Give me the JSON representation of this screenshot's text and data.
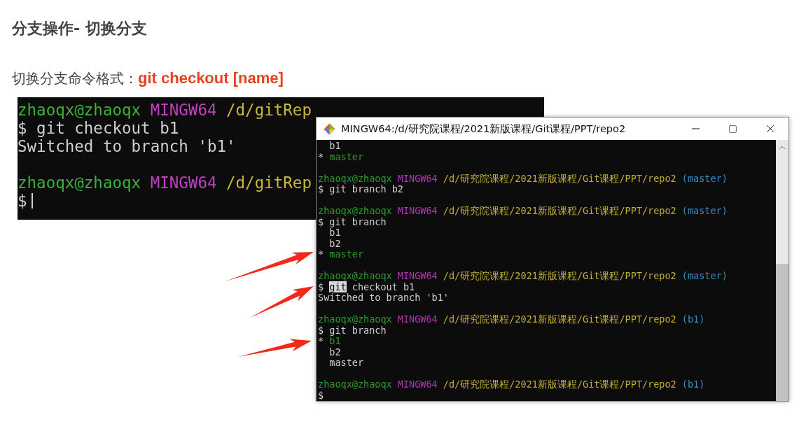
{
  "title": "分支操作- 切换分支",
  "subtitle": {
    "label": "切换分支命令格式：",
    "command": "git checkout [name]"
  },
  "back_terminal": {
    "lines": [
      {
        "kind": "prompt",
        "user": "zhaoqx@zhaoqx",
        "system": "MINGW64",
        "path": "/d/gitRep"
      },
      {
        "kind": "command",
        "prompt": "$",
        "parts": [
          {
            "text": "git checkout b1",
            "selected": false
          }
        ]
      },
      {
        "kind": "output",
        "text": "Switched to branch 'b1'"
      },
      {
        "kind": "blank"
      },
      {
        "kind": "prompt",
        "user": "zhaoqx@zhaoqx",
        "system": "MINGW64",
        "path": "/d/gitRep"
      },
      {
        "kind": "command",
        "prompt": "$",
        "cursor": true
      }
    ]
  },
  "terminal_window": {
    "title": "MINGW64:/d/研究院课程/2021新版课程/Git课程/PPT/repo2",
    "lines": [
      {
        "kind": "branch",
        "current": false,
        "name": "b1"
      },
      {
        "kind": "branch",
        "current": true,
        "marker": "*",
        "name": "master"
      },
      {
        "kind": "blank"
      },
      {
        "kind": "prompt",
        "user": "zhaoqx@zhaoqx",
        "system": "MINGW64",
        "path": "/d/研究院课程/2021新版课程/Git课程/PPT/repo2",
        "branch": "(master)"
      },
      {
        "kind": "command",
        "prompt": "$",
        "parts": [
          {
            "text": "git branch b2",
            "selected": false
          }
        ]
      },
      {
        "kind": "blank"
      },
      {
        "kind": "prompt",
        "user": "zhaoqx@zhaoqx",
        "system": "MINGW64",
        "path": "/d/研究院课程/2021新版课程/Git课程/PPT/repo2",
        "branch": "(master)"
      },
      {
        "kind": "command",
        "prompt": "$",
        "parts": [
          {
            "text": "git branch",
            "selected": false
          }
        ]
      },
      {
        "kind": "branch",
        "current": false,
        "name": "b1"
      },
      {
        "kind": "branch",
        "current": false,
        "name": "b2"
      },
      {
        "kind": "branch",
        "current": true,
        "marker": "*",
        "name": "master"
      },
      {
        "kind": "blank"
      },
      {
        "kind": "prompt",
        "user": "zhaoqx@zhaoqx",
        "system": "MINGW64",
        "path": "/d/研究院课程/2021新版课程/Git课程/PPT/repo2",
        "branch": "(master)"
      },
      {
        "kind": "command",
        "prompt": "$",
        "parts": [
          {
            "text": "git",
            "selected": true
          },
          {
            "text": "checkout b1",
            "selected": false
          }
        ]
      },
      {
        "kind": "output",
        "text": "Switched to branch 'b1'"
      },
      {
        "kind": "blank"
      },
      {
        "kind": "prompt",
        "user": "zhaoqx@zhaoqx",
        "system": "MINGW64",
        "path": "/d/研究院课程/2021新版课程/Git课程/PPT/repo2",
        "branch": "(b1)"
      },
      {
        "kind": "command",
        "prompt": "$",
        "parts": [
          {
            "text": "git branch",
            "selected": false
          }
        ]
      },
      {
        "kind": "branch",
        "current": true,
        "marker": "*",
        "name": "b1"
      },
      {
        "kind": "branch",
        "current": false,
        "name": "b2"
      },
      {
        "kind": "branch",
        "current": false,
        "name": "master"
      },
      {
        "kind": "blank"
      },
      {
        "kind": "prompt",
        "user": "zhaoqx@zhaoqx",
        "system": "MINGW64",
        "path": "/d/研究院课程/2021新版课程/Git课程/PPT/repo2",
        "branch": "(b1)"
      },
      {
        "kind": "command",
        "prompt": "$"
      }
    ]
  }
}
